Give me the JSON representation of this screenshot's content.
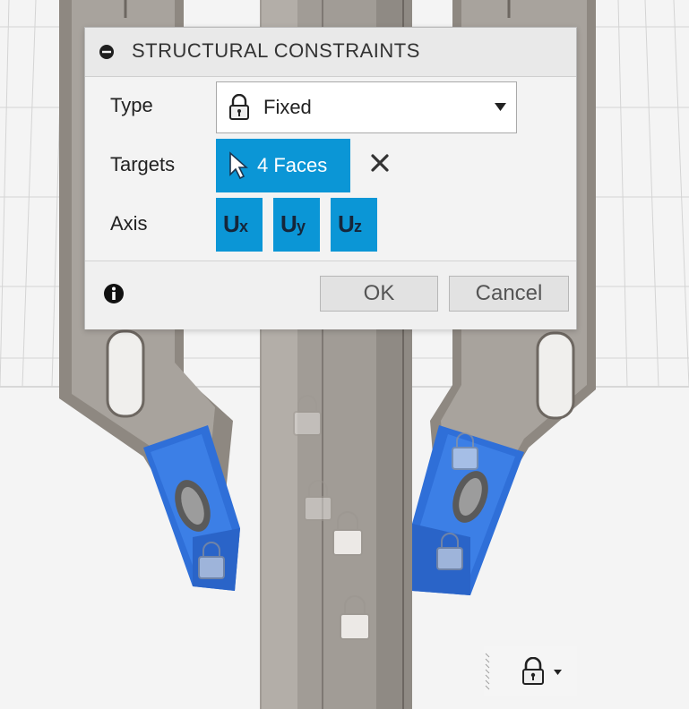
{
  "dialog": {
    "title": "STRUCTURAL CONSTRAINTS",
    "type_label": "Type",
    "type_value": "Fixed",
    "targets_label": "Targets",
    "targets_value": "4 Faces",
    "axis_label": "Axis",
    "axis_buttons": [
      {
        "main": "U",
        "sub": "x"
      },
      {
        "main": "U",
        "sub": "y"
      },
      {
        "main": "U",
        "sub": "z"
      }
    ],
    "ok_label": "OK",
    "cancel_label": "Cancel"
  },
  "icons": {
    "collapse": "minus-circle-icon",
    "type_lock": "lock-icon",
    "type_dropdown": "chevron-down-icon",
    "targets": "cursor-arrow-icon",
    "clear_targets": "close-icon",
    "info": "info-icon",
    "toolbar_lock": "lock-icon",
    "toolbar_dropdown": "chevron-down-icon"
  },
  "colors": {
    "accent": "#0b96d6",
    "selected_face": "#2f6fd8",
    "model_body": "#8a847d",
    "model_tube": "#9d9892"
  }
}
